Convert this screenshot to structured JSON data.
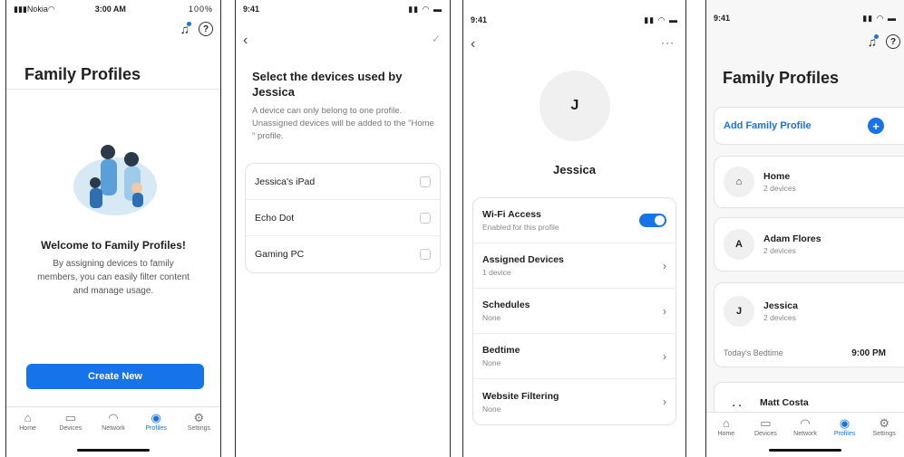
{
  "screen1": {
    "status": {
      "carrier": "Nokia",
      "time": "3:00 AM",
      "battery": "100%"
    },
    "title": "Family Profiles",
    "welcome": "Welcome to Family Profiles!",
    "description": "By assigning devices to family members, you can easily filter content and manage usage.",
    "button": "Create New",
    "tabs": [
      {
        "label": "Home",
        "icon": "home-icon"
      },
      {
        "label": "Devices",
        "icon": "devices-icon"
      },
      {
        "label": "Network",
        "icon": "wifi-icon"
      },
      {
        "label": "Profiles",
        "icon": "profiles-icon"
      },
      {
        "label": "Settings",
        "icon": "gear-icon"
      }
    ],
    "active_tab": "Profiles",
    "accent": "#1673ea"
  },
  "screen2": {
    "time": "9:41",
    "title": "Select the devices used by Jessica",
    "description": "A device can only belong to one profile. Unassigned devices will be added to the \"Home \" profile.",
    "devices": [
      "Jessica's iPad",
      "Echo Dot",
      "Gaming PC"
    ]
  },
  "screen3": {
    "time": "9:41",
    "avatar_initial": "J",
    "name": "Jessica",
    "settings": [
      {
        "label": "Wi-Fi Access",
        "sub": "Enabled for this profile",
        "control": "toggle",
        "on": true
      },
      {
        "label": "Assigned Devices",
        "sub": "1 device",
        "control": "chevron"
      },
      {
        "label": "Schedules",
        "sub": "None",
        "control": "chevron"
      },
      {
        "label": "Bedtime",
        "sub": "None",
        "control": "chevron"
      },
      {
        "label": "Website Filtering",
        "sub": "None",
        "control": "chevron"
      }
    ]
  },
  "screen4": {
    "time": "9:41",
    "title": "Family Profiles",
    "add_label": "Add Family Profile",
    "profiles": [
      {
        "initial": "",
        "icon": "home-icon",
        "name": "Home",
        "sub": "2 devices"
      },
      {
        "initial": "A",
        "name": "Adam Flores",
        "sub": "2 devices"
      },
      {
        "initial": "J",
        "name": "Jessica",
        "sub": "2 devices",
        "bedtime_label": "Today's Bedtime",
        "bedtime": "9:00 PM"
      },
      {
        "initial": "M",
        "name": "Matt Costa",
        "sub": ""
      }
    ],
    "tabs": [
      {
        "label": "Home"
      },
      {
        "label": "Devices"
      },
      {
        "label": "Network"
      },
      {
        "label": "Profiles"
      },
      {
        "label": "Settings"
      }
    ]
  }
}
